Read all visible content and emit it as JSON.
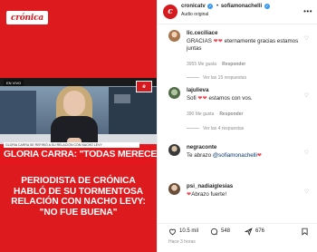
{
  "media": {
    "logo": "crónica",
    "tv_logo": "e",
    "top_tag": "EN VIVO",
    "lower_third_sub": "GLORIA CARRA SE REFIRIÓ A SU RELACIÓN CON NACHO LEVY",
    "lower_third_head": "GLORIA CARRA: \"TODAS MERECEMOS SER ESCUCHADAS\"",
    "caption": "PERIODISTA DE CRÓNICA HABLÓ DE SU TORMENTOSA RELACIÓN CON NACHO LEVY: \"NO FUE BUENA\""
  },
  "header": {
    "owner": "cronicatv",
    "collaborator": "sofiamonachelli",
    "audio": "Audio original",
    "more": "•••"
  },
  "comments": [
    {
      "user": "lic.ceciliace",
      "text_prefix": "GRACIAS ",
      "hearts": "❤❤",
      "text_suffix": " eternamente gracias estamos juntas",
      "likes": "3955 Me gusta",
      "reply": "Responder",
      "view_replies": "Ver las 15 respuestas"
    },
    {
      "user": "lajulieva",
      "text_prefix": "Sofi ",
      "hearts": "❤❤",
      "text_suffix": " estamos con vos.",
      "likes": "390 Me gusta",
      "reply": "Responder",
      "view_replies": "Ver las 4 respuestas"
    },
    {
      "user": "negraconte",
      "text_prefix": "Te abrazo ",
      "mention": "@sofiamonachelli",
      "hearts": "❤",
      "text_suffix": "",
      "likes": "",
      "reply": ""
    },
    {
      "user": "psi_nadiaiglesias",
      "text_prefix": "",
      "hearts": "❤",
      "text_suffix": "Abrazo fuerte!",
      "likes": "",
      "reply": ""
    }
  ],
  "actions": {
    "likes": "10.5 mil",
    "comments": "548",
    "shares": "676"
  },
  "time_ago": "Hace 3 horas",
  "colors": {
    "brand_red": "#d41a1f",
    "heart_red": "#ed4956",
    "verified_blue": "#3897f0",
    "muted_text": "#8e8e8e"
  }
}
